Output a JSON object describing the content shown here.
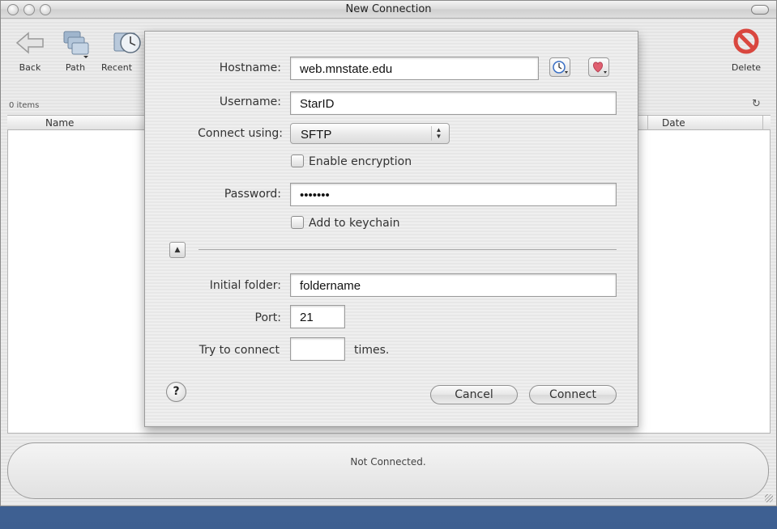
{
  "window": {
    "title": "New Connection"
  },
  "toolbar": {
    "back_label": "Back",
    "path_label": "Path",
    "recent_label": "Recent",
    "delete_label": "Delete",
    "icons": {
      "back": "back-arrow-icon",
      "path": "path-folders-icon",
      "recent": "recent-clock-icon",
      "delete": "delete-icon"
    }
  },
  "browser": {
    "items_count": "0 items",
    "columns": {
      "name": "Name",
      "date": "Date"
    },
    "status": "Not Connected."
  },
  "dialog": {
    "hostname_label": "Hostname:",
    "hostname_value": "web.mnstate.edu",
    "username_label": "Username:",
    "username_value": "StarID",
    "connect_using_label": "Connect using:",
    "protocol_value": "SFTP",
    "encryption_label": "Enable encryption",
    "password_label": "Password:",
    "password_value": "•••••••",
    "keychain_label": "Add to keychain",
    "initial_folder_label": "Initial folder:",
    "initial_folder_value": "foldername",
    "port_label": "Port:",
    "port_value": "21",
    "try_label": "Try to connect",
    "try_value": "",
    "times_label": "times.",
    "cancel_label": "Cancel",
    "connect_label": "Connect",
    "help_label": "?"
  },
  "colors": {
    "accent_delete": "#d9473f",
    "bookmark_heart": "#e06070",
    "history_clock": "#3a6fc4"
  }
}
